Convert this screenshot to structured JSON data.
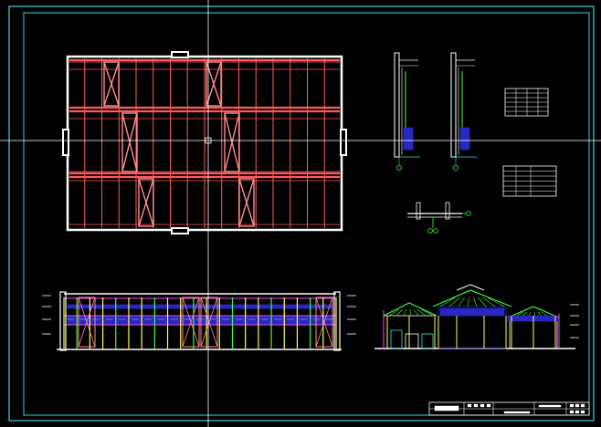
{
  "drawing": {
    "background": "#000000",
    "border_color": "#3fd0e0",
    "crosshair_color": "#ffffff",
    "colors": {
      "beam": "#ff5a5a",
      "brace": "#ff8c8c",
      "wall": "#ffffff",
      "frame_blue": "#2828c0",
      "green": "#40ff40",
      "yellow": "#ffff50",
      "cyan": "#40e0e0",
      "magenta": "#ff40ff"
    }
  },
  "views": {
    "plan": {
      "bays": 16,
      "rows": 3
    },
    "front_elevation": {
      "columns": 22
    },
    "side_elevation": {
      "spans": 3
    }
  },
  "title_block": {
    "cells": 6
  }
}
